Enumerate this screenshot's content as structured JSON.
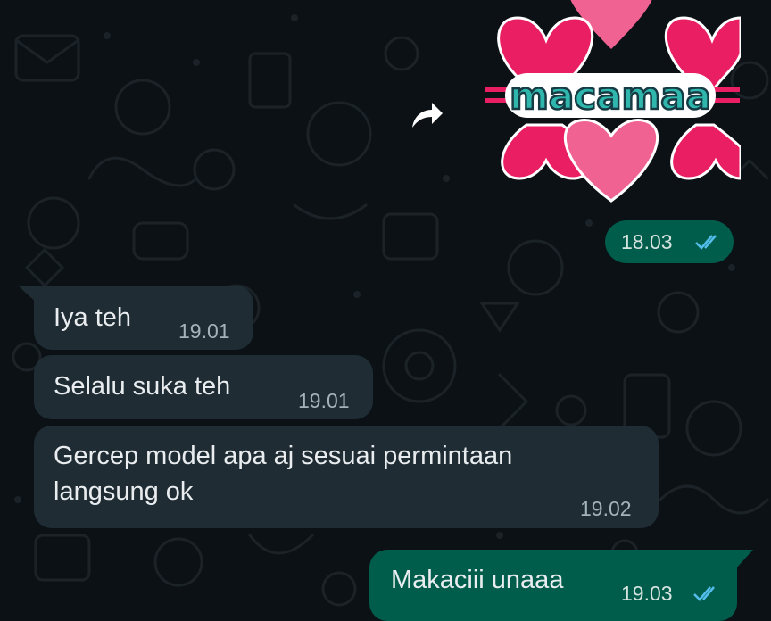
{
  "colors": {
    "background": "#0b1115",
    "incoming_bubble": "#1f2c34",
    "outgoing_bubble": "#005c4b",
    "read_ticks": "#53bdeb"
  },
  "sticker": {
    "text": "macamaa",
    "forward_icon": "forward-arrow-icon"
  },
  "messages": [
    {
      "direction": "out",
      "type": "sticker",
      "time": "18.03",
      "status": "read"
    },
    {
      "direction": "in",
      "text": "Iya teh",
      "time": "19.01"
    },
    {
      "direction": "in",
      "text": "Selalu suka teh",
      "time": "19.01"
    },
    {
      "direction": "in",
      "text": "Gercep model apa aj sesuai permintaan\nlangsung ok",
      "time": "19.02"
    },
    {
      "direction": "out",
      "text": "Makaciii unaaa",
      "time": "19.03",
      "status": "read"
    }
  ]
}
